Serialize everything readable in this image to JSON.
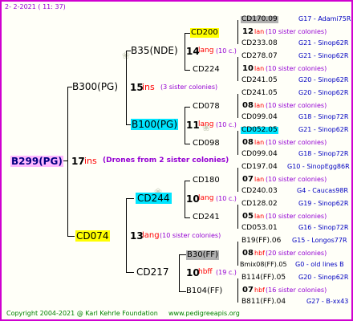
{
  "header": {
    "date": "2-  2-2021 ( 11: 37)"
  },
  "footer": {
    "copyright": "Copyright 2004-2021 @ Karl Kehrle Foundation",
    "site": "www.pedigreeapis.org"
  },
  "root": {
    "id": "B299(PG)",
    "number": "17",
    "ins": "ins",
    "note": "(Drones from 2 sister colonies)"
  },
  "gen1": [
    {
      "id": "B300(PG)",
      "number": "15",
      "ins": "ins",
      "note": "(3 sister colonies)"
    },
    {
      "id": "CD074",
      "number": "13",
      "lang": "lang",
      "note": "(10 sister colonies)"
    }
  ],
  "gen2": [
    {
      "id": "B35(NDE)",
      "number": "14",
      "lang": "lang",
      "note": "(10 c.)"
    },
    {
      "id": "B100(PG)",
      "number": "11",
      "lang": "lang",
      "note": "(10 c.)"
    },
    {
      "id": "CD244",
      "number": "10",
      "lang": "lang",
      "note": "(10 c.)"
    },
    {
      "id": "CD217",
      "number": "10",
      "lang": "hbff",
      "note": "(19 c.)"
    }
  ],
  "gen3": [
    {
      "id": "CD200"
    },
    {
      "id": "CD224"
    },
    {
      "id": "CD078"
    },
    {
      "id": "CD098"
    },
    {
      "id": "CD180"
    },
    {
      "id": "CD241"
    },
    {
      "id": "B30(FF)"
    },
    {
      "id": "B104(FF)"
    }
  ],
  "gen4": [
    {
      "id": "CD170.09",
      "line": "G17 - Adami75R"
    },
    {
      "number": "12",
      "lang": "lan",
      "note": "(10 sister colonies)"
    },
    {
      "id": "CD233.08",
      "line": "G21 - Sinop62R"
    },
    {
      "id": "CD278.07",
      "line": "G21 - Sinop62R"
    },
    {
      "number": "10",
      "lang": "lan",
      "note": "(10 sister colonies)"
    },
    {
      "id": "CD241.05",
      "line": "G20 - Sinop62R"
    },
    {
      "id": "CD241.05",
      "line": "G20 - Sinop62R"
    },
    {
      "number": "08",
      "lang": "lan",
      "note": "(10 sister colonies)"
    },
    {
      "id": "CD099.04",
      "line": "G18 - Sinop72R"
    },
    {
      "id": "CD052.05",
      "line": "G21 - Sinop62R"
    },
    {
      "number": "08",
      "lang": "lan",
      "note": "(10 sister colonies)"
    },
    {
      "id": "CD099.04",
      "line": "G18 - Sinop72R"
    },
    {
      "id": "CD197.04",
      "line": "G10 - SinopEgg86R"
    },
    {
      "number": "07",
      "lang": "lan",
      "note": "(10 sister colonies)"
    },
    {
      "id": "CD240.03",
      "line": "G4 - Caucas98R"
    },
    {
      "id": "CD128.02",
      "line": "G19 - Sinop62R"
    },
    {
      "number": "05",
      "lang": "lan",
      "note": "(10 sister colonies)"
    },
    {
      "id": "CD053.01",
      "line": "G16 - Sinop72R"
    },
    {
      "id": "B19(FF).06",
      "line": "G15 - Longos77R"
    },
    {
      "number": "08",
      "lang": "hbf",
      "note": "(20 sister colonies)"
    },
    {
      "id": "Bmix08(FF).05",
      "line": "G0 - old lines B"
    },
    {
      "id": "B114(FF).05",
      "line": "G20 - Sinop62R"
    },
    {
      "number": "07",
      "lang": "hbf",
      "note": "(16 sister colonies)"
    },
    {
      "id": "B811(FF).04",
      "line": "G27 - B-xx43"
    }
  ],
  "colors": {
    "border": "#d000d0",
    "header": "#9400d3",
    "footer": "#008000",
    "ins": "#ff0000",
    "lang": "#ff0000",
    "note": "#9400d3",
    "line_label": "#0000c0",
    "hl_yellow": "#ffff00",
    "hl_cyan": "#00e5ff",
    "hl_gray": "#b0b0b0",
    "hl_pink": "#ffb8ff"
  }
}
